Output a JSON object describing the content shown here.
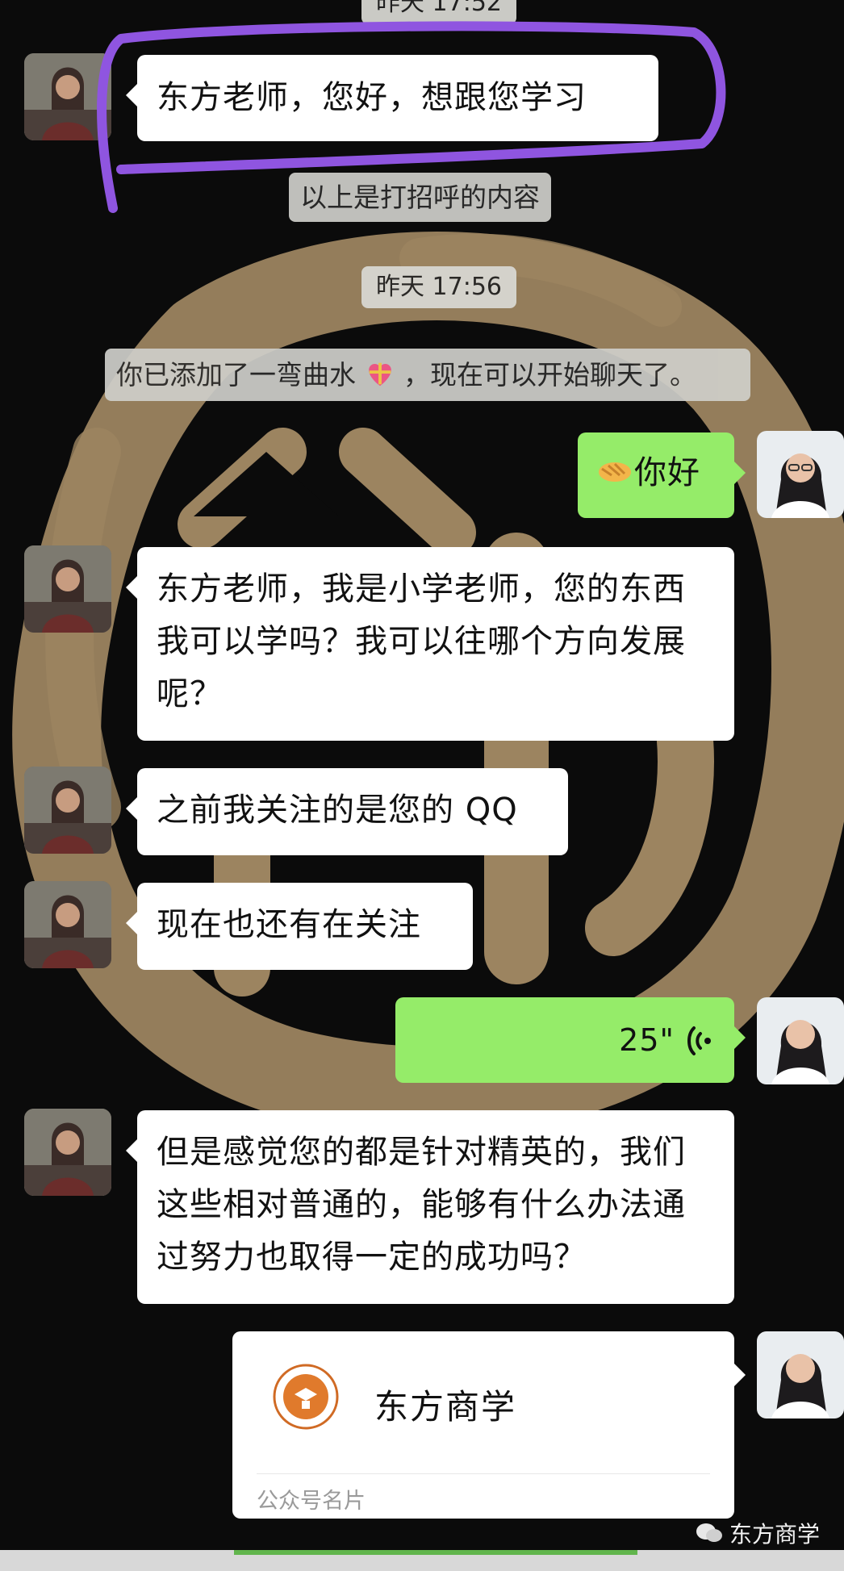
{
  "timestamps": {
    "top_partial": "昨天 17:52",
    "second": "昨天 17:56"
  },
  "system": {
    "greeting_note": "以上是打招呼的内容",
    "added_friend_before": "你已添加了一弯曲水",
    "added_friend_emoji": "gift-heart-emoji",
    "added_friend_after": "，现在可以开始聊天了。"
  },
  "messages": [
    {
      "side": "in",
      "text": "东方老师，您好，想跟您学习"
    },
    {
      "side": "out",
      "emoji": "handshake-emoji",
      "text": "你好"
    },
    {
      "side": "in",
      "text": "东方老师，我是小学老师，您的东西我可以学吗？我可以往哪个方向发展呢？"
    },
    {
      "side": "in",
      "text": "之前我关注的是您的 QQ"
    },
    {
      "side": "in",
      "text": "现在也还有在关注"
    },
    {
      "side": "out",
      "voice_duration": "25\""
    },
    {
      "side": "in",
      "text": "但是感觉您的都是针对精英的，我们这些相对普通的，能够有什么办法通过努力也取得一定的成功吗？"
    }
  ],
  "card": {
    "name": "东方商学",
    "type_label": "公众号名片"
  },
  "watermark": {
    "text": "东方商学",
    "icon": "wechat-icon"
  },
  "colors": {
    "outgoing_bubble": "#95ec69",
    "incoming_bubble": "#ffffff",
    "emblem_gold": "#9c8460",
    "highlight_stroke": "#8f55e0"
  }
}
